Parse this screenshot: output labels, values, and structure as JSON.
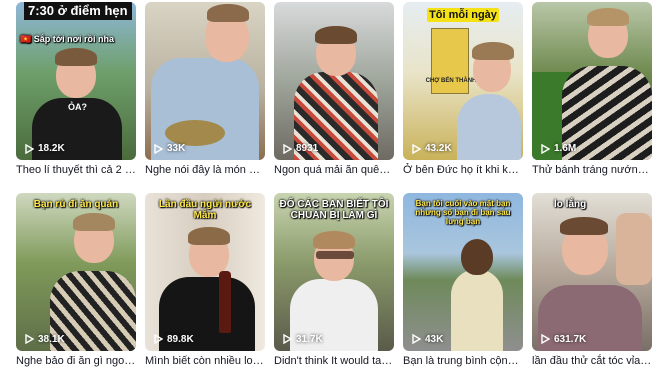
{
  "videos": [
    {
      "overlay": "7:30 ở điểm hẹn",
      "overlay2": "🇻🇳 Sắp tới nơi rồi nha",
      "views": "18.2K",
      "caption": "Theo lí thuyết thì cả 2 đều..."
    },
    {
      "overlay": "",
      "views": "33K",
      "caption": "Nghe nói đây là món ăn s..."
    },
    {
      "overlay": "",
      "views": "8931",
      "caption": "Ngon quá mải ăn quên la..."
    },
    {
      "overlay": "Tôi mỗi ngày",
      "sign": "CHỢ BẾN THÀNH",
      "views": "43.2K",
      "caption": "Ở bên Đức họ ít khi khen ..."
    },
    {
      "overlay": "",
      "views": "1.6M",
      "caption": "Thử bánh tráng nướng ng..."
    },
    {
      "overlay": "Bạn rủ đi ăn quán",
      "views": "38.1K",
      "caption": "Nghe bảo đi ăn gì ngon lắ..."
    },
    {
      "overlay": "Lần đầu ngửi nước Mắm",
      "views": "89.8K",
      "caption": "Mình biết còn nhiều loại k..."
    },
    {
      "overlay": "ĐỐ CÁC BẠN BIẾT TÔI CHUẨN BỊ LÀM GÌ",
      "views": "31.7K",
      "caption": "Didn't think It would tast..."
    },
    {
      "overlay": "Bạn tôi cuối vào mặt bạn nhưng số bạn đi bạn sau lưng bạn",
      "views": "43K",
      "caption": "Bạn là trung bình cộng củ..."
    },
    {
      "overlay": "lo lắng",
      "views": "631.7K",
      "caption": "lần đầu thử cắt tóc vỉa hè ..."
    }
  ],
  "shirt_text": "ỎA?",
  "icon": "play-outline-icon"
}
